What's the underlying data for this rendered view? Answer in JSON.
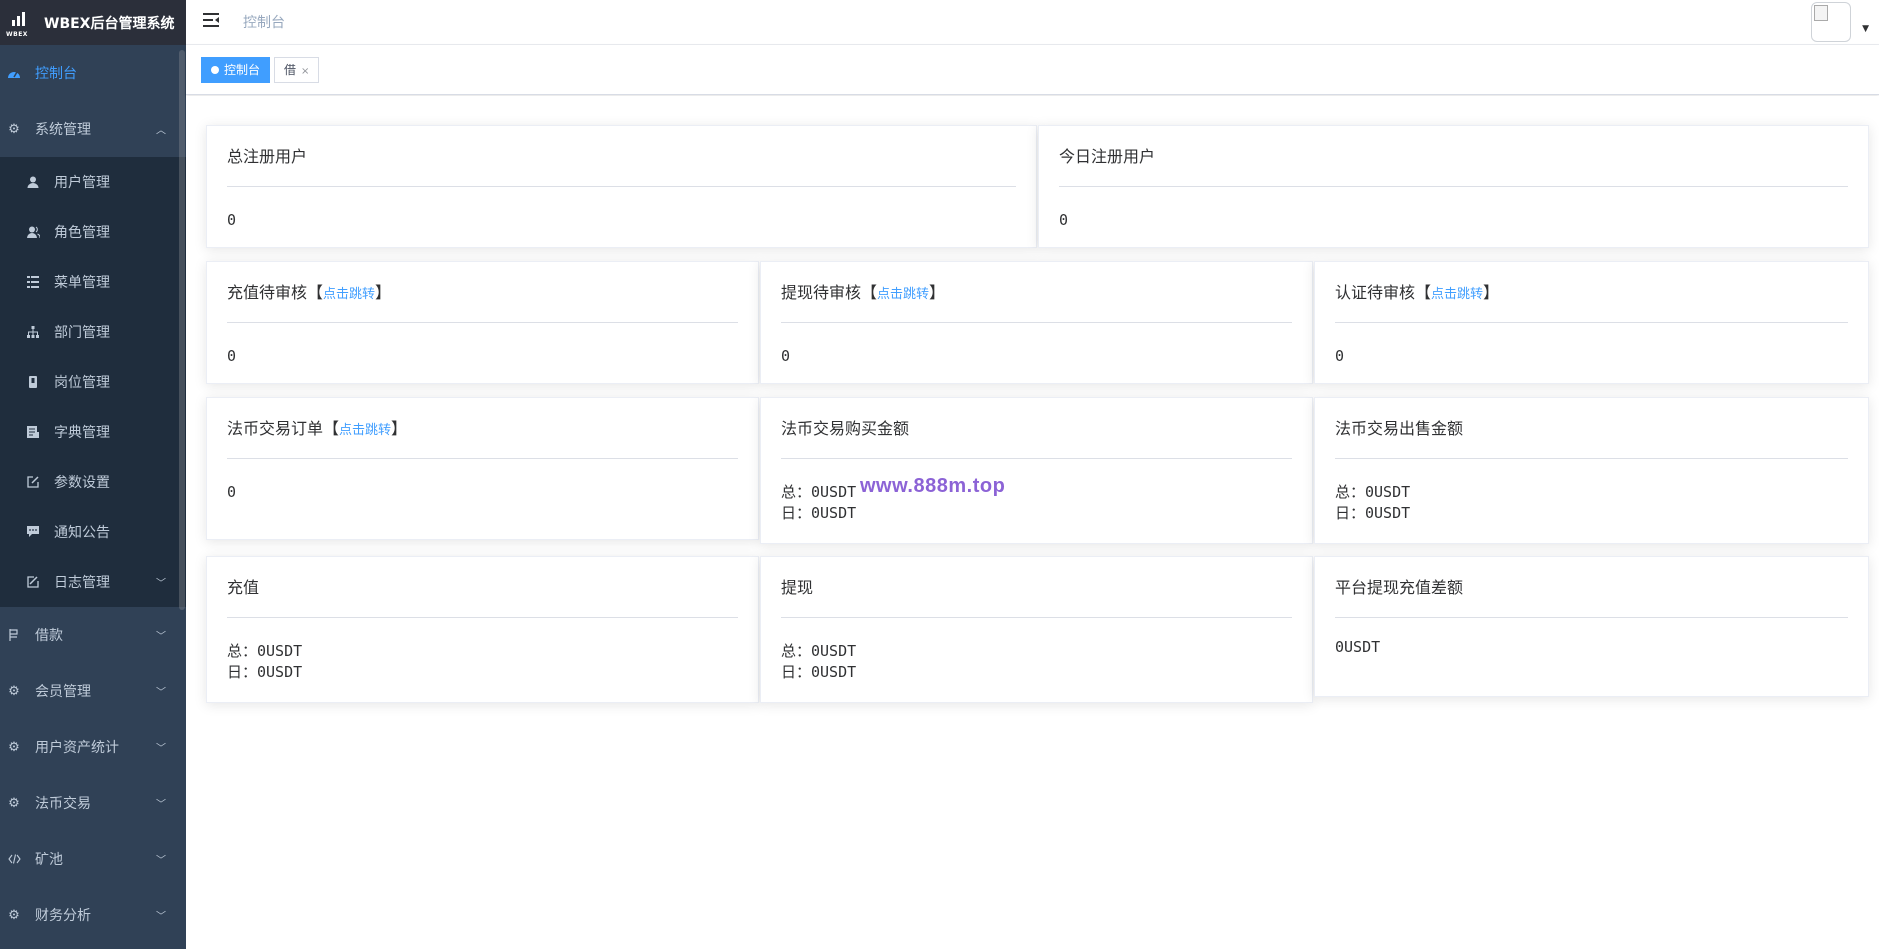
{
  "app": {
    "title": "WBEX后台管理系统",
    "logo_text": "WBEX"
  },
  "sidebar": {
    "dashboard": "控制台",
    "system": {
      "label": "系统管理",
      "items": [
        {
          "label": "用户管理",
          "icon": "user-icon"
        },
        {
          "label": "角色管理",
          "icon": "peoples-icon"
        },
        {
          "label": "菜单管理",
          "icon": "tree-table-icon"
        },
        {
          "label": "部门管理",
          "icon": "tree-icon"
        },
        {
          "label": "岗位管理",
          "icon": "post-icon"
        },
        {
          "label": "字典管理",
          "icon": "dict-icon"
        },
        {
          "label": "参数设置",
          "icon": "edit-icon"
        },
        {
          "label": "通知公告",
          "icon": "message-icon"
        },
        {
          "label": "日志管理",
          "icon": "log-icon"
        }
      ]
    },
    "loan": "借款",
    "members": "会员管理",
    "assets": "用户资产统计",
    "fiat": "法币交易",
    "mining": "矿池",
    "finance": "财务分析"
  },
  "navbar": {
    "breadcrumb": "控制台"
  },
  "tags": {
    "active": "控制台",
    "second": "借",
    "close": "×"
  },
  "cards": {
    "total_users": {
      "title": "总注册用户",
      "value": "0"
    },
    "today_users": {
      "title": "今日注册用户",
      "value": "0"
    },
    "recharge_pending": {
      "title": "充值待审核",
      "link": "点击跳转",
      "value": "0"
    },
    "withdraw_pending": {
      "title": "提现待审核",
      "link": "点击跳转",
      "value": "0"
    },
    "verify_pending": {
      "title": "认证待审核",
      "link": "点击跳转",
      "value": "0"
    },
    "fiat_orders": {
      "title": "法币交易订单",
      "link": "点击跳转",
      "value": "0"
    },
    "fiat_buy": {
      "title": "法币交易购买金额",
      "total": "总：0USDT",
      "day": "日：0USDT"
    },
    "fiat_sell": {
      "title": "法币交易出售金额",
      "total": "总：0USDT",
      "day": "日：0USDT"
    },
    "recharge": {
      "title": "充值",
      "total": "总：0USDT",
      "day": "日：0USDT"
    },
    "withdraw": {
      "title": "提现",
      "total": "总：0USDT",
      "day": "日：0USDT"
    },
    "diff": {
      "title": "平台提现充值差额",
      "value": "0USDT"
    }
  },
  "bracket_open": "【",
  "bracket_close": "】",
  "watermark": "www.888m.top",
  "colors": {
    "sidebar_bg": "#304156",
    "submenu_bg": "#1f2d3d",
    "accent": "#409eff",
    "text_muted": "#bfcbd9"
  }
}
